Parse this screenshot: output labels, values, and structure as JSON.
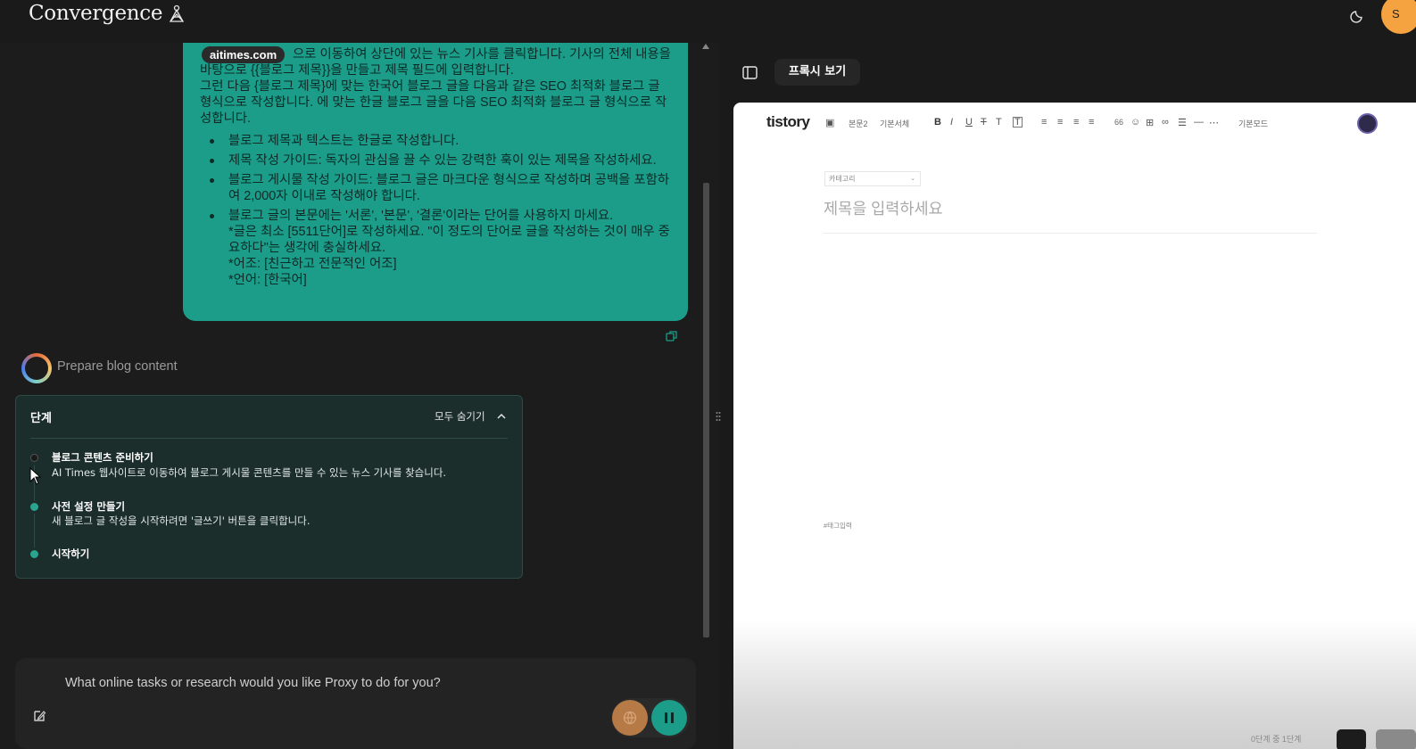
{
  "app": {
    "brand": "Convergence",
    "avatar_initial": "S"
  },
  "chat": {
    "site_chip": "aitimes.com",
    "message": {
      "line1": "으로 이동하여 상단에 있는 뉴스 기사를 클릭합니다. 기사의 전체 내용을 바탕으로 {{블로그 제목}}을 만들고 제목 필드에 입력합니다.",
      "line2": "그런 다음 {블로그 제목}에 맞는 한국어 블로그 글을 다음과 같은 SEO 최적화 블로그 글 형식으로 작성합니다. 에 맞는 한글 블로그 글을 다음 SEO 최적화 블로그 글 형식으로 작성합니다.",
      "bullets": [
        "블로그 제목과 텍스트는 한글로 작성합니다.",
        "제목 작성 가이드: 독자의 관심을 끌 수 있는 강력한 훅이 있는 제목을 작성하세요.",
        "블로그 게시물 작성 가이드: 블로그 글은 마크다운 형식으로 작성하며 공백을 포함하여 2,000자 이내로 작성해야 합니다."
      ],
      "bullet4_a": "블로그 글의 본문에는 '서론', '본문', '결론'이라는 단어를 사용하지 마세요.",
      "bullet4_b": "*글은 최소 [5511단어]로 작성하세요. \"이 정도의 단어로 글을 작성하는 것이 매우 중요하다\"는 생각에 충실하세요.",
      "bullet4_c": "*어조: [친근하고 전문적인 어조]",
      "bullet4_d": "*언어: [한국어]"
    },
    "task_title": "Prepare blog content",
    "steps": {
      "heading": "단계",
      "hide_all": "모두 숨기기",
      "items": [
        {
          "title": "블로그 콘텐츠 준비하기",
          "desc": "AI Times 웹사이트로 이동하여 블로그 게시물 콘텐츠를 만들 수 있는 뉴스 기사를 찾습니다."
        },
        {
          "title": "사전 설정 만들기",
          "desc": "새 블로그 글 작성을 시작하려면 '글쓰기' 버튼을 클릭합니다."
        },
        {
          "title": "시작하기",
          "desc": ""
        }
      ]
    },
    "input_placeholder": "What online tasks or research would you like Proxy to do for you?"
  },
  "proxy": {
    "tab_label": "프록시 보기",
    "tistory": {
      "logo": "tistory",
      "toolbar": {
        "paragraph": "본문2",
        "font": "기본서체",
        "mode": "기본모드",
        "quote": "66"
      },
      "category_placeholder": "카테고리",
      "title_placeholder": "제목을 입력하세요",
      "tag_placeholder": "#태그입력",
      "footer_text": "0단계 중 1단계"
    }
  },
  "colors": {
    "accent": "#1b9d8a",
    "avatar": "#f5a240",
    "background": "#1c1c1c"
  },
  "icons": [
    "logo-mark-icon",
    "moon-icon",
    "copy-icon",
    "chevron-up-icon",
    "cursor-icon",
    "edit-icon",
    "globe-icon",
    "pause-icon",
    "panel-toggle-icon",
    "drag-handle-icon"
  ]
}
